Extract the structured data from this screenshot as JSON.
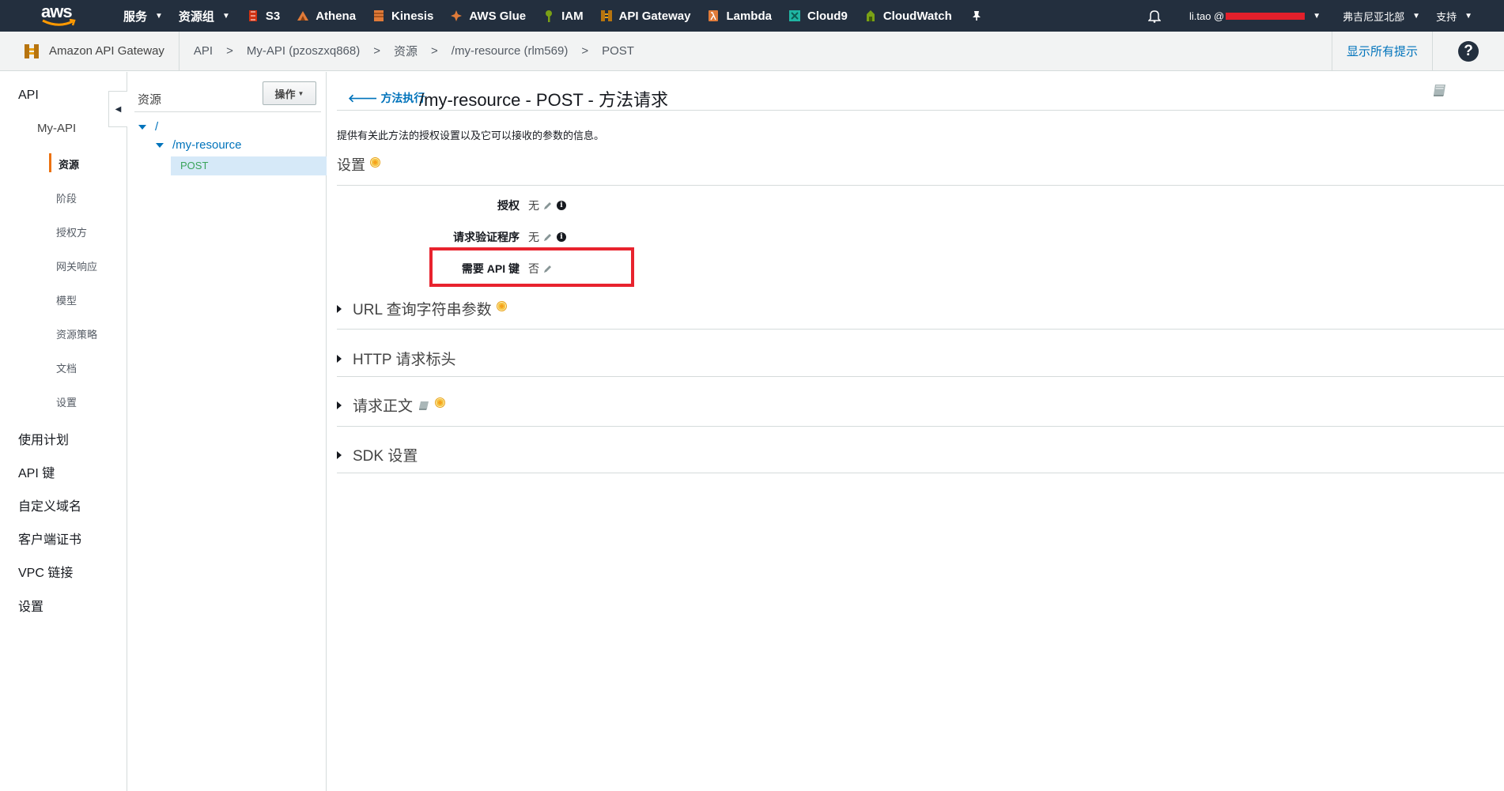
{
  "topnav": {
    "logo_text": "aws",
    "services_label": "服务",
    "resource_groups_label": "资源组",
    "shortcuts": [
      {
        "label": "S3",
        "icon": "s3-icon",
        "color": "#d13212"
      },
      {
        "label": "Athena",
        "icon": "athena-icon",
        "color": "#e07b39"
      },
      {
        "label": "Kinesis",
        "icon": "kinesis-icon",
        "color": "#e07b39"
      },
      {
        "label": "AWS Glue",
        "icon": "glue-icon",
        "color": "#e07b39"
      },
      {
        "label": "IAM",
        "icon": "iam-icon",
        "color": "#7aa116"
      },
      {
        "label": "API Gateway",
        "icon": "api-gateway-icon",
        "color": "#e8a117"
      },
      {
        "label": "Lambda",
        "icon": "lambda-icon",
        "color": "#e07b39"
      },
      {
        "label": "Cloud9",
        "icon": "cloud9-icon",
        "color": "#1fb5a3"
      },
      {
        "label": "CloudWatch",
        "icon": "cloudwatch-icon",
        "color": "#7aa116"
      }
    ],
    "user_label": "li.tao @ ",
    "region_label": "弗吉尼亚北部",
    "support_label": "支持"
  },
  "subbar": {
    "service_name": "Amazon API Gateway",
    "breadcrumbs": [
      "API",
      "My-API (pzoszxq868)",
      "资源",
      "/my-resource (rlm569)",
      "POST"
    ],
    "separator": ">",
    "hints_label": "显示所有提示",
    "help_glyph": "?"
  },
  "leftnav": {
    "api": "API",
    "my_api": "My-API",
    "items": [
      "资源",
      "阶段",
      "授权方",
      "网关响应",
      "模型",
      "资源策略",
      "文档",
      "设置"
    ],
    "top_items": [
      "使用计划",
      "API 键",
      "自定义域名",
      "客户端证书",
      "VPC 链接",
      "设置"
    ],
    "accent_color": "#ec7211"
  },
  "tree": {
    "title": "资源",
    "actions_label": "操作",
    "root": "/",
    "child": "/my-resource",
    "method": "POST"
  },
  "main": {
    "back_label": "方法执行",
    "title": "/my-resource - POST - 方法请求",
    "description": "提供有关此方法的授权设置以及它可以接收的参数的信息。",
    "settings_heading": "设置",
    "fields": [
      {
        "label": "授权",
        "value": "无"
      },
      {
        "label": "请求验证程序",
        "value": "无"
      },
      {
        "label": "需要 API 键",
        "value": "否"
      }
    ],
    "info_glyph": "i",
    "sections": [
      "URL 查询字符串参数",
      "HTTP 请求标头",
      "请求正文",
      "SDK 设置"
    ]
  }
}
